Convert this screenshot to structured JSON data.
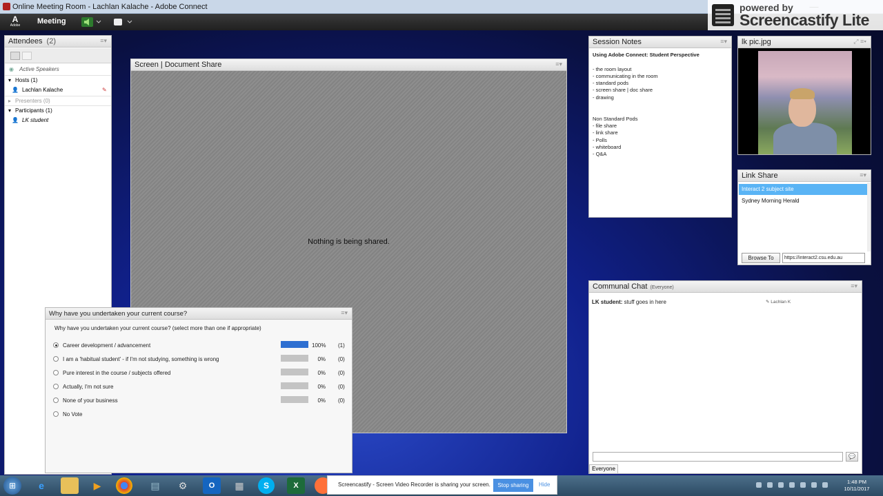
{
  "window": {
    "title": "Online Meeting Room - Lachlan Kalache - Adobe Connect",
    "min": "—",
    "max": "☐",
    "close": "✕"
  },
  "menubar": {
    "logo": "A",
    "logo_sub": "Adobe",
    "meeting_label": "Meeting"
  },
  "castify_badge": {
    "line1": "powered by",
    "line2": "Screencastify Lite"
  },
  "attendees": {
    "title": "Attendees",
    "count": "(2)",
    "active_speakers": "Active Speakers",
    "hosts_label": "Hosts (1)",
    "host_name": "Lachlan Kalache",
    "presenters_label": "Presenters (0)",
    "participants_label": "Participants (1)",
    "participant_name": "LK student"
  },
  "screenshare": {
    "title": "Screen | Document Share",
    "empty_message": "Nothing is being shared."
  },
  "poll": {
    "title": "Why have you undertaken your current course?",
    "question": "Why have you undertaken your current course? (select more than one if appropriate)",
    "options": [
      {
        "label": "Career development / advancement",
        "percent": "100%",
        "count": "(1)",
        "fraction": 1.0,
        "selected": true
      },
      {
        "label": "I am a 'habitual student' - if I'm not studying, something is wrong",
        "percent": "0%",
        "count": "(0)",
        "fraction": 0,
        "selected": false
      },
      {
        "label": "Pure interest in the course / subjects offered",
        "percent": "0%",
        "count": "(0)",
        "fraction": 0,
        "selected": false
      },
      {
        "label": "Actually, I'm not sure",
        "percent": "0%",
        "count": "(0)",
        "fraction": 0,
        "selected": false
      },
      {
        "label": "None of your business",
        "percent": "0%",
        "count": "(0)",
        "fraction": 0,
        "selected": false
      },
      {
        "label": "No Vote",
        "percent": "",
        "count": "",
        "fraction": null,
        "selected": false
      }
    ]
  },
  "notes": {
    "title": "Session Notes",
    "heading": "Using Adobe Connect: Student Perspective",
    "lines": [
      "",
      "- the room layout",
      "- communicating in the room",
      "- standard pods",
      "- screen share | doc share",
      "- drawing",
      "",
      "",
      "Non Standard Pods",
      "- file share",
      "- link share",
      "- Polls",
      "- whiteboard",
      "- Q&A"
    ]
  },
  "photo": {
    "title": "lk pic.jpg"
  },
  "links": {
    "title": "Link Share",
    "items": [
      "Interact 2 subject site",
      "Sydney Morning Herald"
    ],
    "browse_label": "Browse To",
    "url_value": "https://interact2.csu.edu.au"
  },
  "chat": {
    "title": "Communal Chat",
    "audience": "(Everyone)",
    "message_sender": "LK student:",
    "message_text": " stuff goes in here",
    "typing_user": "Lachlan K",
    "send_icon": "💬",
    "recipient_button": "Everyone"
  },
  "taskbar": {
    "castify_message": "Screencastify - Screen Video Recorder is sharing your screen.",
    "stop_sharing": "Stop sharing",
    "hide": "Hide",
    "time": "1:48 PM",
    "date": "10/11/2017"
  },
  "colors": {
    "accent_blue": "#2e6fd1",
    "link_selected": "#5ab4f5",
    "bg_navy": "#10208a"
  }
}
